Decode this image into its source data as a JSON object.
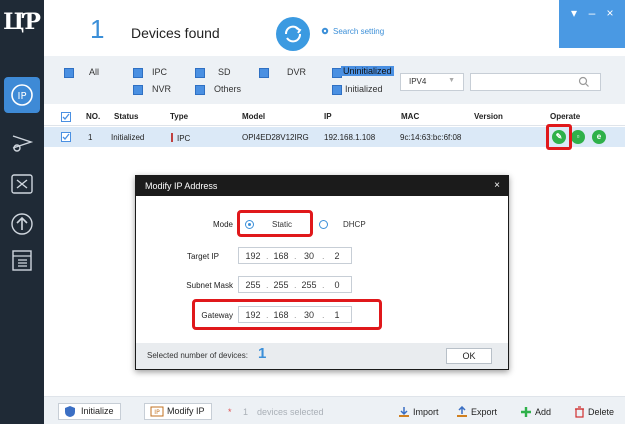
{
  "header": {
    "device_count": "1",
    "title": "Devices found",
    "search_setting": "Search setting"
  },
  "window_controls": {
    "menu": "▾",
    "minimize": "–",
    "close": "×"
  },
  "filters": {
    "all": "All",
    "ipc": "IPC",
    "nvr": "NVR",
    "sd": "SD",
    "others": "Others",
    "dvr": "DVR",
    "uninitialized": "Uninitialized",
    "initialized": "Initialized",
    "ip_version": "IPV4",
    "search_value": ""
  },
  "table": {
    "headers": {
      "no": "NO.",
      "status": "Status",
      "type": "Type",
      "model": "Model",
      "ip": "IP",
      "mac": "MAC",
      "version": "Version",
      "operate": "Operate"
    },
    "rows": [
      {
        "no": "1",
        "status": "Initialized",
        "type": "IPC",
        "model": "OPI4ED28V12IRG",
        "ip": "192.168.1.108",
        "mac": "9c:14:63:bc:6f:08",
        "version": ""
      }
    ]
  },
  "modal": {
    "title": "Modify IP Address",
    "close": "×",
    "mode_label": "Mode",
    "static_label": "Static",
    "dhcp_label": "DHCP",
    "target_ip_label": "Target IP",
    "target_ip": [
      "192",
      "168",
      "30",
      "2"
    ],
    "subnet_label": "Subnet Mask",
    "subnet": [
      "255",
      "255",
      "255",
      "0"
    ],
    "gateway_label": "Gateway",
    "gateway": [
      "192",
      "168",
      "30",
      "1"
    ],
    "selected_label": "Selected number of devices:",
    "selected_count": "1",
    "ok": "OK"
  },
  "bottom": {
    "initialize": "Initialize",
    "modify_ip": "Modify IP",
    "selected_star": "*",
    "selected_count": "1",
    "selected_text": "devices selected",
    "import": "Import",
    "export": "Export",
    "add": "Add",
    "delete": "Delete"
  },
  "colors": {
    "sidebar": "#1f2a36",
    "accent": "#3b8fd8",
    "highlight_box": "#e0181b",
    "operate_icon": "#2fb14a"
  },
  "icons": {
    "sidebar": [
      "app-logo-icon",
      "ip-config-icon",
      "upgrade-icon",
      "tools-icon",
      "update-icon",
      "doc-icon"
    ],
    "operate": [
      "edit-icon",
      "web-icon",
      "info-icon"
    ]
  }
}
